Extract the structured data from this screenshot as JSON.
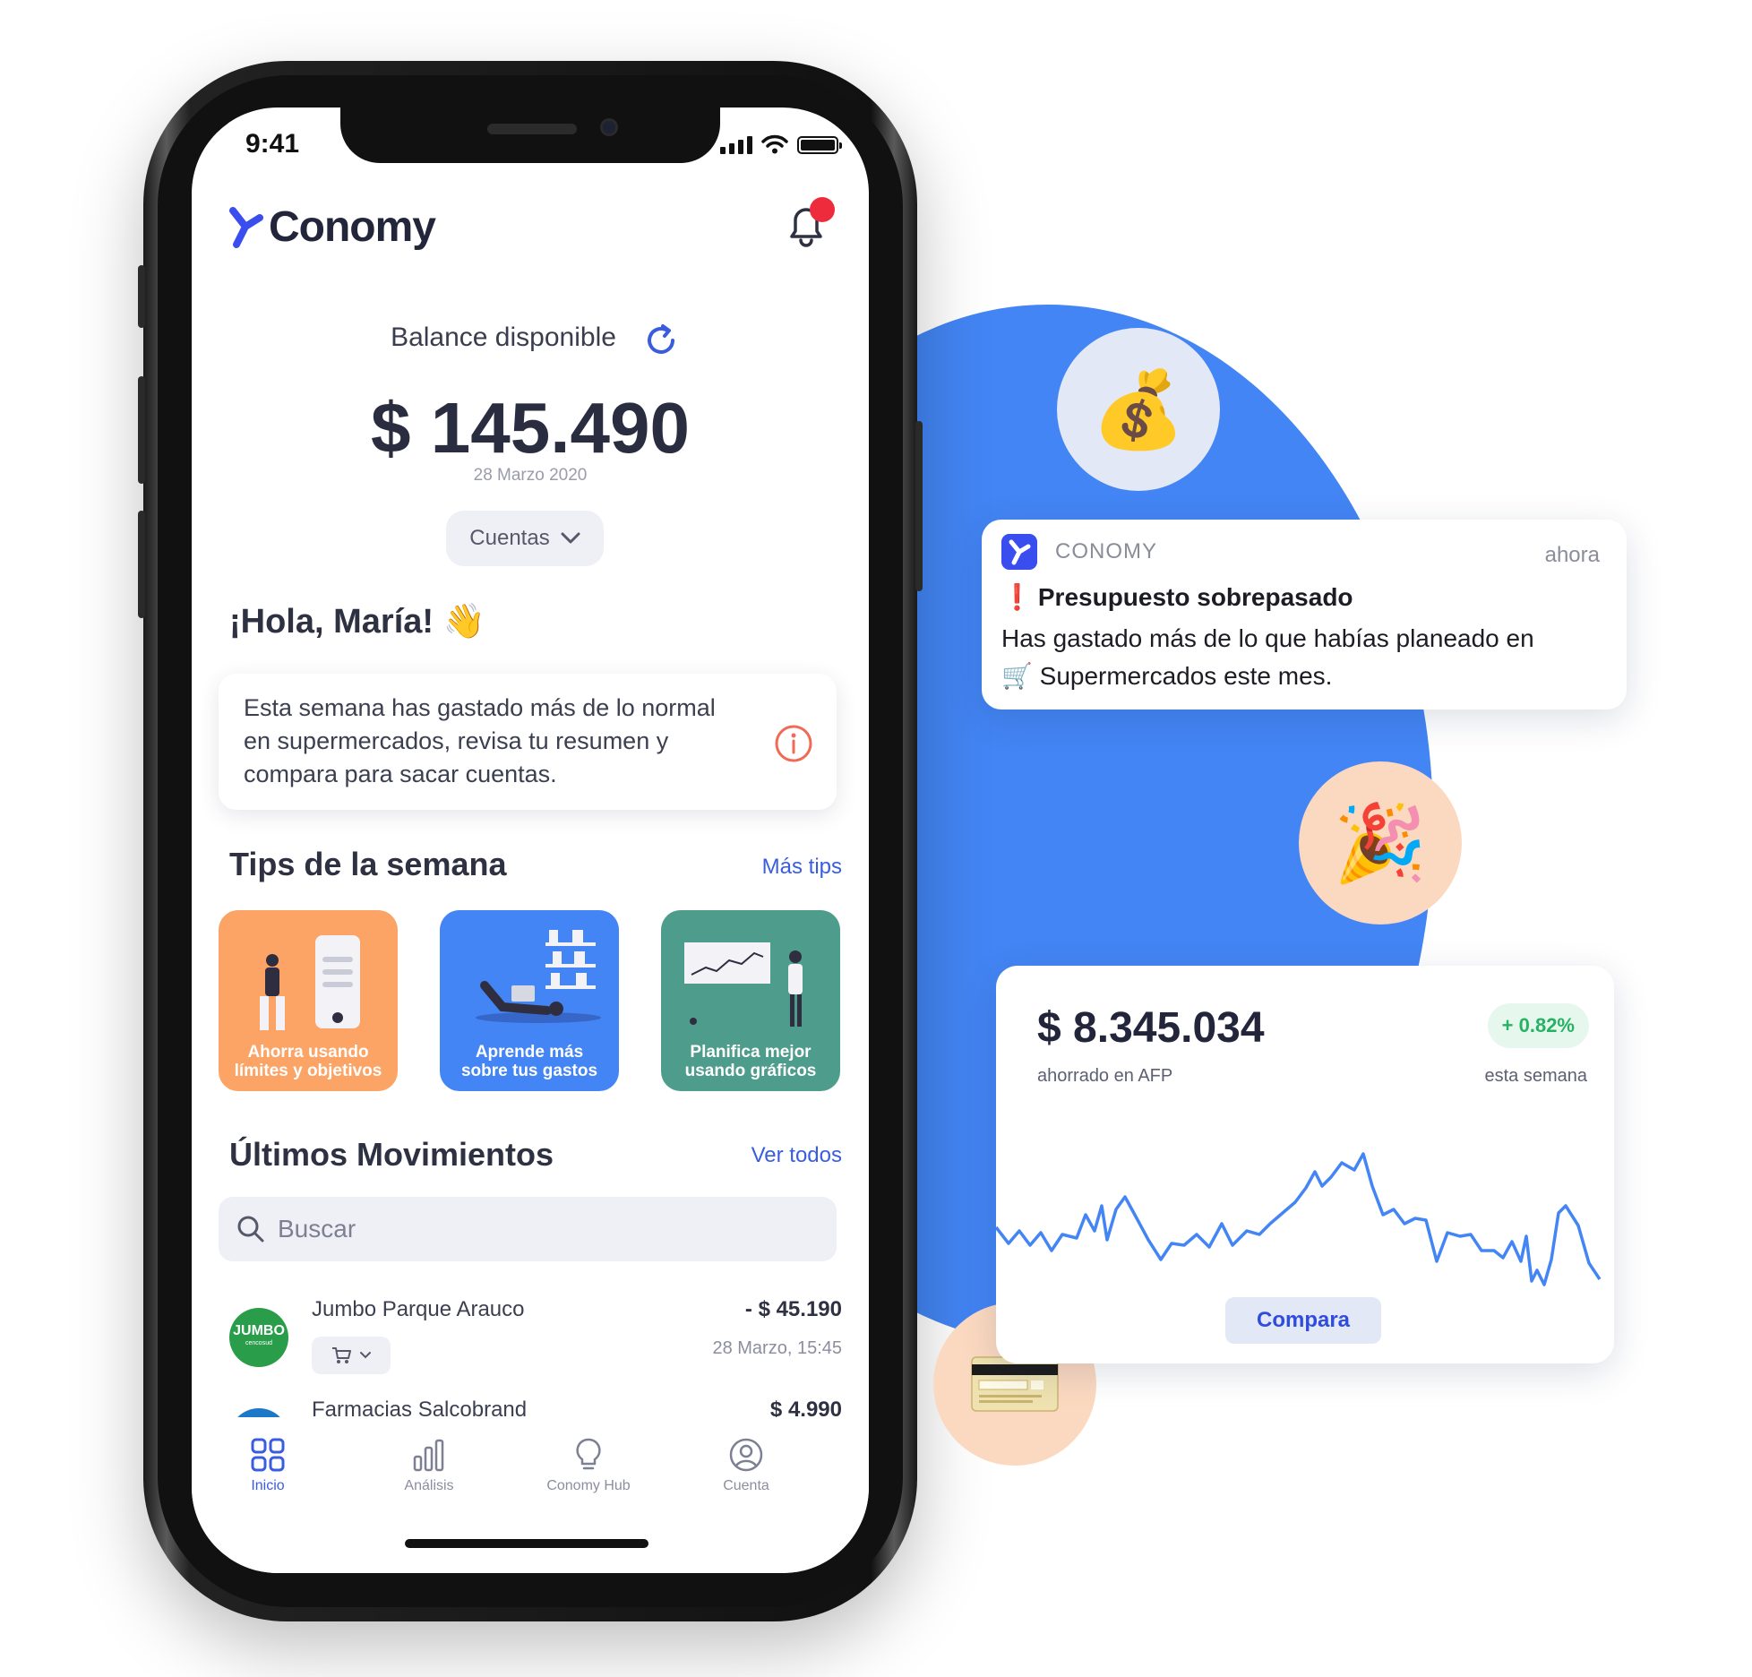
{
  "status_bar": {
    "time": "9:41"
  },
  "app": {
    "name": "Conomy"
  },
  "balance": {
    "label": "Balance disponible",
    "amount": "$ 145.490",
    "date": "28 Marzo 2020",
    "accounts_label": "Cuentas"
  },
  "greeting": "¡Hola, María! 👋",
  "insight": {
    "text": "Esta semana has gastado más de lo normal en supermercados, revisa tu resumen y compara para sacar cuentas."
  },
  "tips": {
    "title": "Tips de la semana",
    "more_label": "Más tips",
    "items": [
      {
        "label_line1": "Ahorra usando",
        "label_line2": "límites y objetivos",
        "color": "#fba466"
      },
      {
        "label_line1": "Aprende más",
        "label_line2": "sobre tus gastos",
        "color": "#4385f4"
      },
      {
        "label_line1": "Planifica mejor",
        "label_line2": "usando gráficos",
        "color": "#4e9c8b"
      }
    ]
  },
  "movements": {
    "title": "Últimos Movimientos",
    "see_all_label": "Ver todos",
    "search_placeholder": "Buscar",
    "items": [
      {
        "merchant": "Jumbo Parque Arauco",
        "logo_text": "JUMBO",
        "logo_sub": "cencosud",
        "amount": "- $ 45.190",
        "date": "28 Marzo, 15:45"
      },
      {
        "merchant": "Farmacias Salcobrand",
        "amount": "$ 4.990"
      }
    ]
  },
  "tabbar": {
    "items": [
      {
        "label": "Inicio",
        "icon": "grid-icon",
        "active": true
      },
      {
        "label": "Análisis",
        "icon": "bar-chart-icon",
        "active": false
      },
      {
        "label": "Conomy Hub",
        "icon": "lightbulb-icon",
        "active": false
      },
      {
        "label": "Cuenta",
        "icon": "user-circle-icon",
        "active": false
      }
    ]
  },
  "notification": {
    "app": "CONOMY",
    "time": "ahora",
    "title_mark": "❗",
    "title": "Presupuesto sobrepasado",
    "body_line1": "Has gastado más de lo que habías planeado en",
    "body_line2": "🛒 Supermercados este mes."
  },
  "bubbles": [
    {
      "emoji": "💰",
      "color": "#e3e8f6"
    },
    {
      "emoji": "🎉",
      "color": "#fbd9c0"
    },
    {
      "icon": "credit-card-icon",
      "color": "#fbd9c0"
    }
  ],
  "afp": {
    "amount": "$ 8.345.034",
    "subtitle": "ahorrado en AFP",
    "change": "+ 0.82%",
    "change_subtitle": "esta semana",
    "button_label": "Compara"
  },
  "colors": {
    "brand": "#3a5de0",
    "accent_blue": "#4385f4",
    "alert_red": "#ee2a3d",
    "positive_green": "#27b163"
  }
}
